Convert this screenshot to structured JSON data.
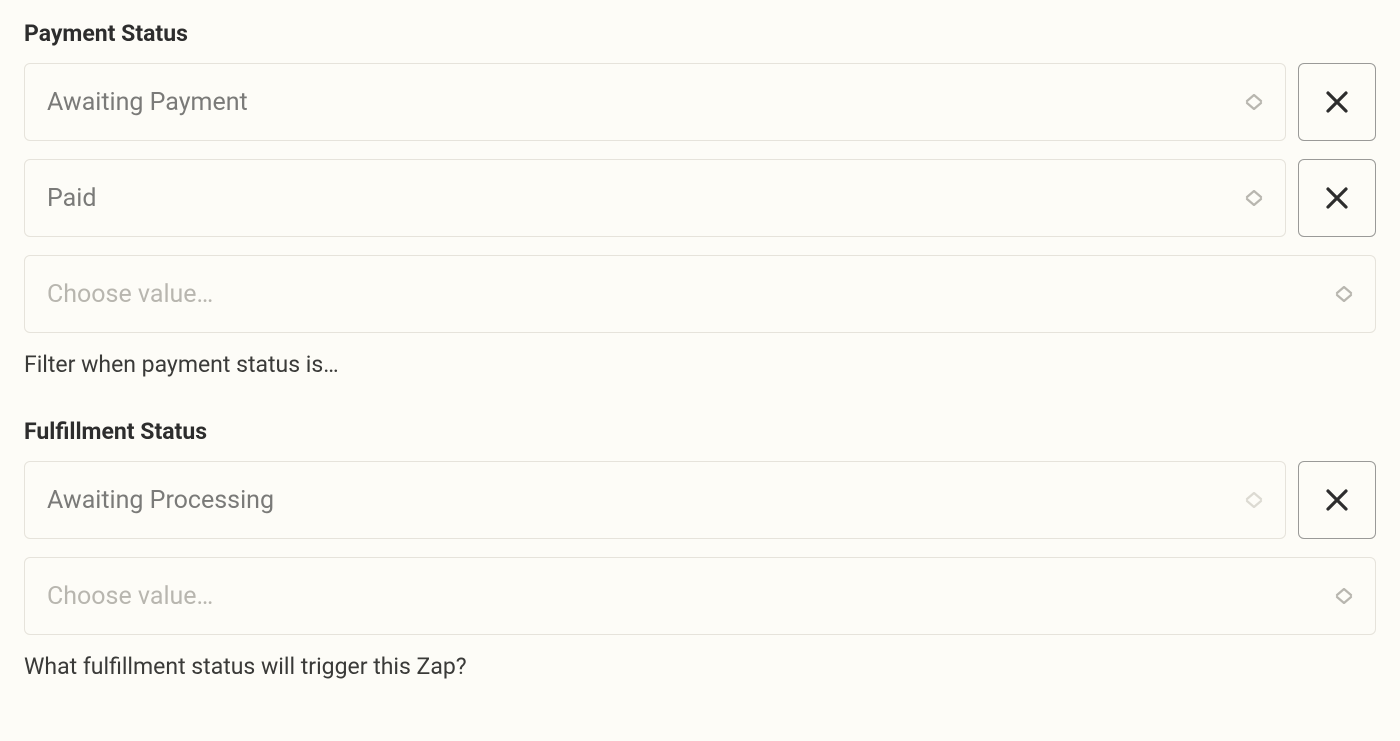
{
  "payment_status": {
    "label": "Payment Status",
    "values": [
      {
        "text": "Awaiting Payment",
        "is_placeholder": false,
        "removable": true
      },
      {
        "text": "Paid",
        "is_placeholder": false,
        "removable": true
      },
      {
        "text": "Choose value…",
        "is_placeholder": true,
        "removable": false
      }
    ],
    "help": "Filter when payment status is…"
  },
  "fulfillment_status": {
    "label": "Fulfillment Status",
    "values": [
      {
        "text": "Awaiting Processing",
        "is_placeholder": false,
        "removable": true
      },
      {
        "text": "Choose value…",
        "is_placeholder": true,
        "removable": false
      }
    ],
    "help": "What fulfillment status will trigger this Zap?"
  }
}
